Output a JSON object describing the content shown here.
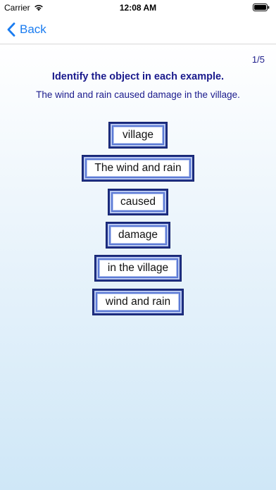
{
  "status_bar": {
    "carrier": "Carrier",
    "time": "12:08 AM"
  },
  "nav": {
    "back_label": "Back"
  },
  "quiz": {
    "counter": "1/5",
    "title": "Identify the object in each example.",
    "sentence": "The wind and rain caused damage in the village.",
    "options": [
      "village",
      "The wind and rain",
      "caused",
      "damage",
      "in the village",
      "wind and rain"
    ]
  },
  "colors": {
    "accent": "#1a7cf0",
    "text_navy": "#1a1a8c",
    "button_border": "#1e2f85"
  }
}
